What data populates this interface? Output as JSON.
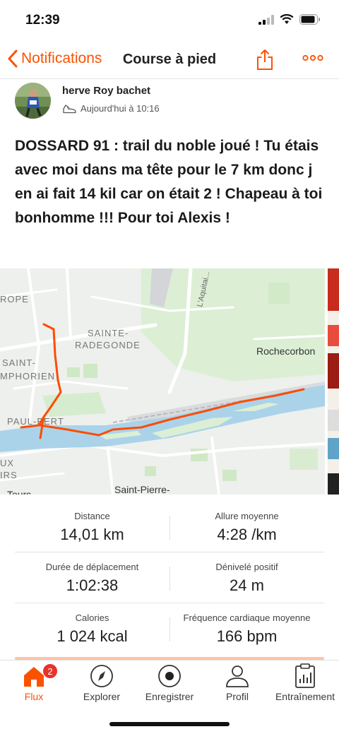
{
  "status_bar": {
    "time": "12:39"
  },
  "nav": {
    "back_label": "Notifications",
    "title": "Course à pied"
  },
  "activity": {
    "athlete_name": "herve Roy bachet",
    "timestamp": "Aujourd'hui à 10:16",
    "title": "DOSSARD 91 : trail du noble joué ! Tu étais avec moi dans ma tête pour le 7 km donc j en ai fait 14 kil car on était 2 ! Chapeau à toi bonhomme !!! Pour toi Alexis !"
  },
  "map": {
    "labels": {
      "rope": "ROPE",
      "sainte": "SAINTE-",
      "radegonde": "RADEGONDE",
      "saint": "SAINT-",
      "mphorien": "MPHORIEN",
      "rochecorbon": "Rochecorbon",
      "paul_bert": "PAUL-BERT",
      "ux": "UX",
      "irs": "IRS",
      "saint_pierre": "Saint-Pierre-",
      "tours": "Tours",
      "aquitaine": "L'Aquitai..."
    },
    "route_color": "#fc4c02",
    "river_color": "#aad3ea"
  },
  "stats": [
    {
      "label": "Distance",
      "value": "14,01 km"
    },
    {
      "label": "Allure moyenne",
      "value": "4:28 /km"
    },
    {
      "label": "Durée de déplacement",
      "value": "1:02:38"
    },
    {
      "label": "Dénivelé positif",
      "value": "24 m"
    },
    {
      "label": "Calories",
      "value": "1 024 kcal"
    },
    {
      "label": "Fréquence cardiaque moyenne",
      "value": "166 bpm"
    }
  ],
  "tabs": [
    {
      "label": "Flux",
      "icon": "home-icon",
      "badge": "2",
      "active": true
    },
    {
      "label": "Explorer",
      "icon": "compass-icon"
    },
    {
      "label": "Enregistrer",
      "icon": "record-icon"
    },
    {
      "label": "Profil",
      "icon": "profile-icon"
    },
    {
      "label": "Entraînement",
      "icon": "training-icon"
    }
  ],
  "colors": {
    "accent": "#fc5200",
    "badge": "#e8322c"
  }
}
